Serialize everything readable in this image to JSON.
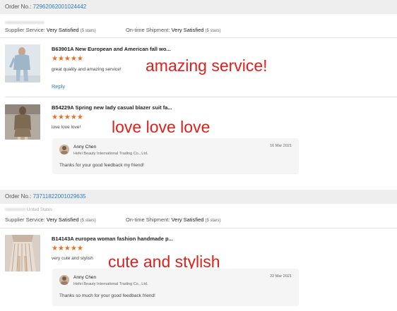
{
  "orders": [
    {
      "order_label": "Order No.:",
      "order_number": "72962062001024442",
      "buyer_text": "",
      "supplier_service_label": "Supplier Service:",
      "supplier_service_value": "Very Satisfied",
      "supplier_service_stars": "(5 stars)",
      "shipment_label": "On-time Shipment:",
      "shipment_value": "Very Satisfied",
      "shipment_stars": "(5 stars)",
      "items": [
        {
          "title": "B63901A New European and American fall wo...",
          "rating_stars": "★★★★★",
          "review": "great quality and amazing service!",
          "overlay": "amazing service!",
          "reply_link": "Reply"
        },
        {
          "title": "B54229A Spring new lady casual blazer suit fa...",
          "rating_stars": "★★★★★",
          "review": "love love love!",
          "overlay": "love love love",
          "seller_reply": {
            "name": "Anny Chen",
            "company": "Hefei Beauty International Trading Co., Ltd.",
            "date": "16 Mar 2021",
            "message": "Thanks for your good feedback my friend!"
          }
        }
      ]
    },
    {
      "order_label": "Order No.:",
      "order_number": "73711822001029635",
      "buyer_text": "United States",
      "supplier_service_label": "Supplier Service:",
      "supplier_service_value": "Very Satisfied",
      "supplier_service_stars": "(5 stars)",
      "shipment_label": "On-time Shipment:",
      "shipment_value": "Very Satisfied",
      "shipment_stars": "(5 stars)",
      "items": [
        {
          "title": "B14143A europea woman fashion handmade p...",
          "rating_stars": "★★★★★",
          "review": "very cute and stylish",
          "overlay": "cute and stylish",
          "seller_reply": {
            "name": "Anny Chen",
            "company": "Hefei Beauty International Trading Co., Ltd.",
            "date": "22 Mar 2021",
            "message": "Thanks so much for your good feedback friend!"
          }
        }
      ]
    }
  ],
  "colors": {
    "link": "#2d7fc4",
    "star": "#f26d21",
    "overlay_text": "#e0201b",
    "header_bg": "#eeeeee"
  }
}
